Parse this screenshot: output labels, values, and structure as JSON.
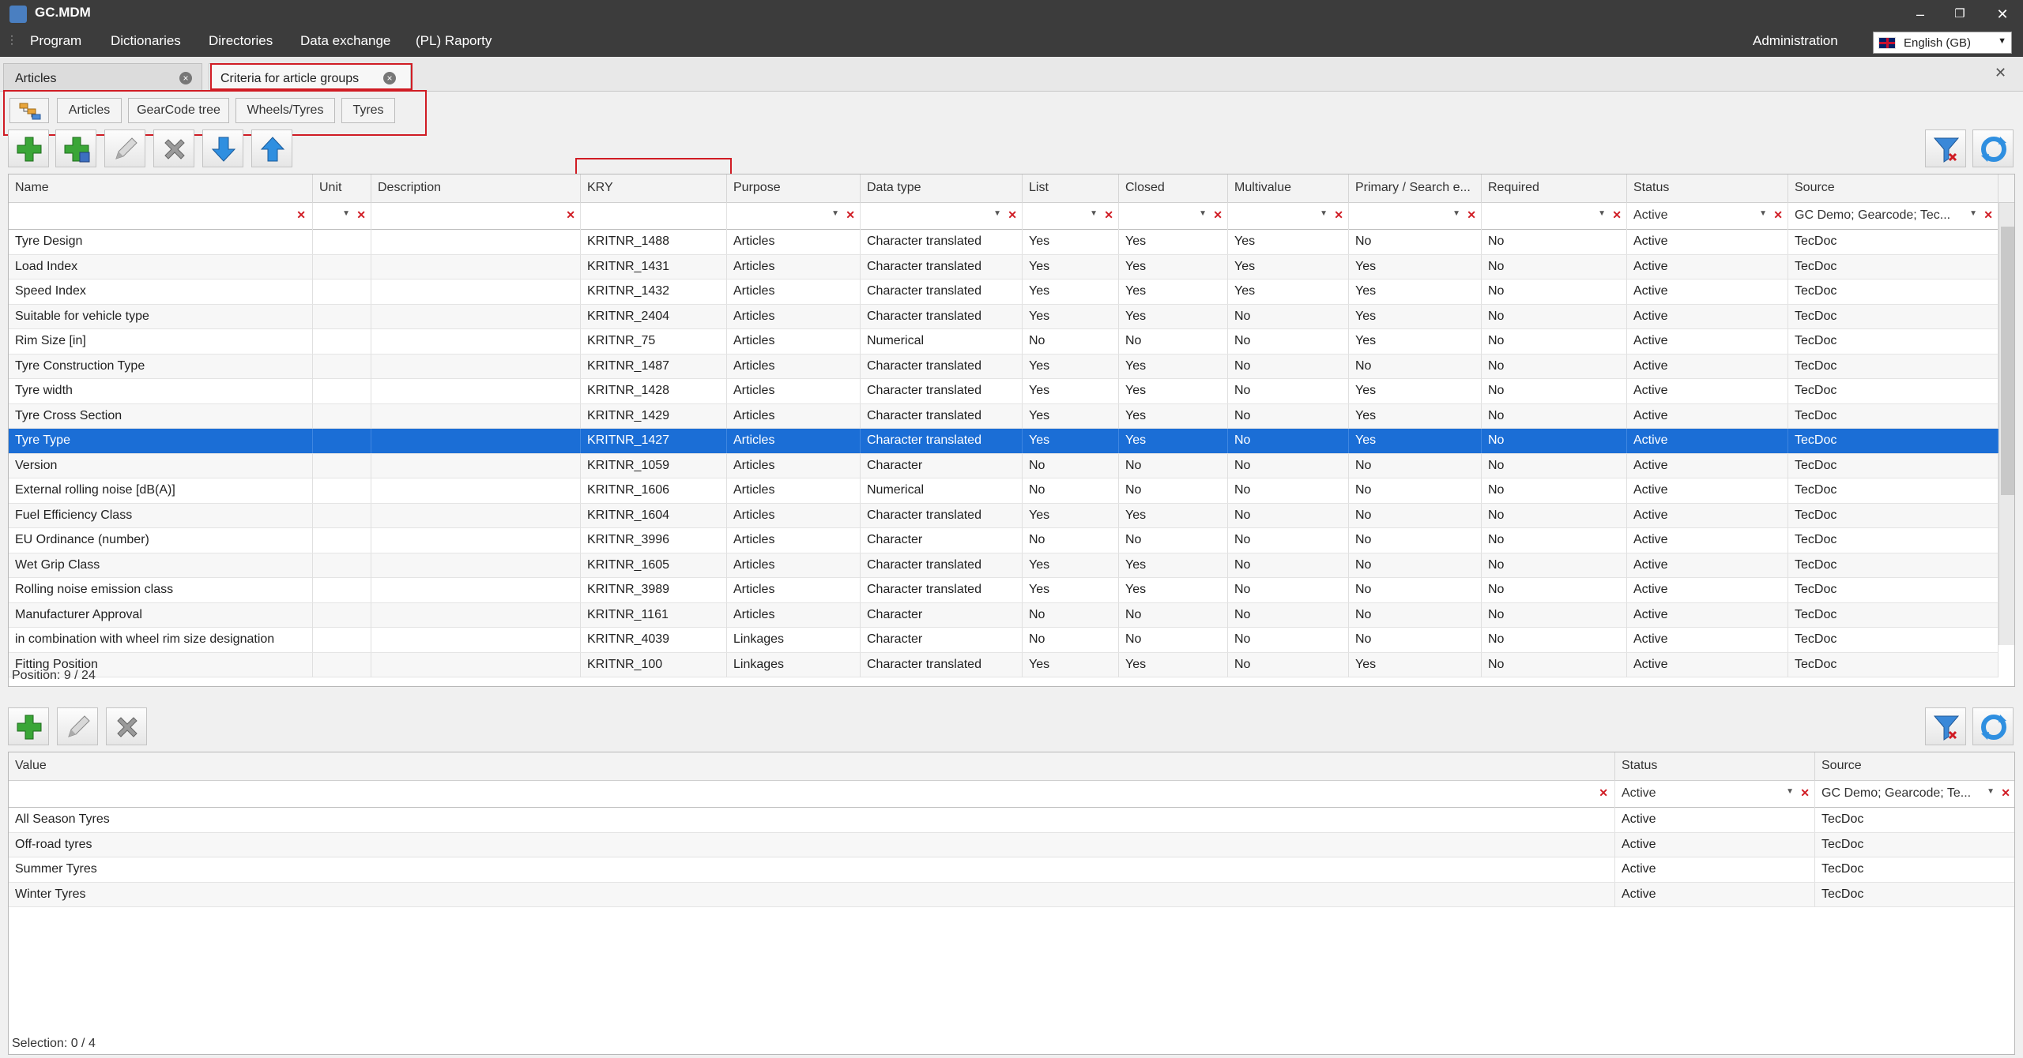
{
  "app": {
    "title": "GC.MDM"
  },
  "window_controls": {
    "minimize": "–",
    "restore": "❐",
    "close": "✕"
  },
  "menu": [
    "Program",
    "Dictionaries",
    "Directories",
    "Data exchange",
    "(PL) Raporty"
  ],
  "admin_label": "Administration",
  "language": {
    "value": "English (GB)",
    "flag_icon": "uk-flag-icon"
  },
  "doc_tabs": [
    {
      "label": "Articles",
      "active": false
    },
    {
      "label": "Criteria for article groups",
      "active": true
    }
  ],
  "sub_tabs": [
    "Articles",
    "GearCode tree",
    "Wheels/Tyres",
    "Tyres"
  ],
  "toolbar_icons": [
    "add-icon",
    "add-with-link-icon",
    "edit-icon",
    "delete-icon",
    "move-down-icon",
    "move-up-icon"
  ],
  "toolbar_right_icons": [
    "clear-filter-icon",
    "refresh-icon"
  ],
  "criteria_grid": {
    "columns": [
      "Name",
      "Unit",
      "Description",
      "KRY",
      "Purpose",
      "Data type",
      "List",
      "Closed",
      "Multivalue",
      "Primary / Search e...",
      "Required",
      "Status",
      "Source"
    ],
    "filters": {
      "Status": "Active",
      "Source": "GC Demo; Gearcode; Tec..."
    },
    "selected_index": 8,
    "rows": [
      [
        "Tyre Design",
        "",
        "",
        "KRITNR_1488",
        "Articles",
        "Character translated",
        "Yes",
        "Yes",
        "Yes",
        "No",
        "No",
        "Active",
        "TecDoc"
      ],
      [
        "Load Index",
        "",
        "",
        "KRITNR_1431",
        "Articles",
        "Character translated",
        "Yes",
        "Yes",
        "Yes",
        "Yes",
        "No",
        "Active",
        "TecDoc"
      ],
      [
        "Speed Index",
        "",
        "",
        "KRITNR_1432",
        "Articles",
        "Character translated",
        "Yes",
        "Yes",
        "Yes",
        "Yes",
        "No",
        "Active",
        "TecDoc"
      ],
      [
        "Suitable for vehicle type",
        "",
        "",
        "KRITNR_2404",
        "Articles",
        "Character translated",
        "Yes",
        "Yes",
        "No",
        "Yes",
        "No",
        "Active",
        "TecDoc"
      ],
      [
        "Rim Size [in]",
        "",
        "",
        "KRITNR_75",
        "Articles",
        "Numerical",
        "No",
        "No",
        "No",
        "Yes",
        "No",
        "Active",
        "TecDoc"
      ],
      [
        "Tyre Construction Type",
        "",
        "",
        "KRITNR_1487",
        "Articles",
        "Character translated",
        "Yes",
        "Yes",
        "No",
        "No",
        "No",
        "Active",
        "TecDoc"
      ],
      [
        "Tyre width",
        "",
        "",
        "KRITNR_1428",
        "Articles",
        "Character translated",
        "Yes",
        "Yes",
        "No",
        "Yes",
        "No",
        "Active",
        "TecDoc"
      ],
      [
        "Tyre Cross Section",
        "",
        "",
        "KRITNR_1429",
        "Articles",
        "Character translated",
        "Yes",
        "Yes",
        "No",
        "Yes",
        "No",
        "Active",
        "TecDoc"
      ],
      [
        "Tyre Type",
        "",
        "",
        "KRITNR_1427",
        "Articles",
        "Character translated",
        "Yes",
        "Yes",
        "No",
        "Yes",
        "No",
        "Active",
        "TecDoc"
      ],
      [
        "Version",
        "",
        "",
        "KRITNR_1059",
        "Articles",
        "Character",
        "No",
        "No",
        "No",
        "No",
        "No",
        "Active",
        "TecDoc"
      ],
      [
        "External rolling noise [dB(A)]",
        "",
        "",
        "KRITNR_1606",
        "Articles",
        "Numerical",
        "No",
        "No",
        "No",
        "No",
        "No",
        "Active",
        "TecDoc"
      ],
      [
        "Fuel Efficiency Class",
        "",
        "",
        "KRITNR_1604",
        "Articles",
        "Character translated",
        "Yes",
        "Yes",
        "No",
        "No",
        "No",
        "Active",
        "TecDoc"
      ],
      [
        "EU Ordinance (number)",
        "",
        "",
        "KRITNR_3996",
        "Articles",
        "Character",
        "No",
        "No",
        "No",
        "No",
        "No",
        "Active",
        "TecDoc"
      ],
      [
        "Wet Grip Class",
        "",
        "",
        "KRITNR_1605",
        "Articles",
        "Character translated",
        "Yes",
        "Yes",
        "No",
        "No",
        "No",
        "Active",
        "TecDoc"
      ],
      [
        "Rolling noise emission class",
        "",
        "",
        "KRITNR_3989",
        "Articles",
        "Character translated",
        "Yes",
        "Yes",
        "No",
        "No",
        "No",
        "Active",
        "TecDoc"
      ],
      [
        "Manufacturer Approval",
        "",
        "",
        "KRITNR_1161",
        "Articles",
        "Character",
        "No",
        "No",
        "No",
        "No",
        "No",
        "Active",
        "TecDoc"
      ],
      [
        "in combination with wheel rim size designation",
        "",
        "",
        "KRITNR_4039",
        "Linkages",
        "Character",
        "No",
        "No",
        "No",
        "No",
        "No",
        "Active",
        "TecDoc"
      ],
      [
        "Fitting Position",
        "",
        "",
        "KRITNR_100",
        "Linkages",
        "Character translated",
        "Yes",
        "Yes",
        "No",
        "Yes",
        "No",
        "Active",
        "TecDoc"
      ]
    ],
    "position_text": "Position: 9 / 24"
  },
  "values_toolbar_icons": [
    "add-icon",
    "edit-icon",
    "delete-icon"
  ],
  "values_grid": {
    "columns": [
      "Value",
      "Status",
      "Source"
    ],
    "filters": {
      "Status": "Active",
      "Source": "GC Demo; Gearcode; Te..."
    },
    "rows": [
      [
        "All Season Tyres",
        "Active",
        "TecDoc"
      ],
      [
        "Off-road tyres",
        "Active",
        "TecDoc"
      ],
      [
        "Summer Tyres",
        "Active",
        "TecDoc"
      ],
      [
        "Winter Tyres",
        "Active",
        "TecDoc"
      ]
    ],
    "selection_text": "Selection: 0 / 4"
  }
}
